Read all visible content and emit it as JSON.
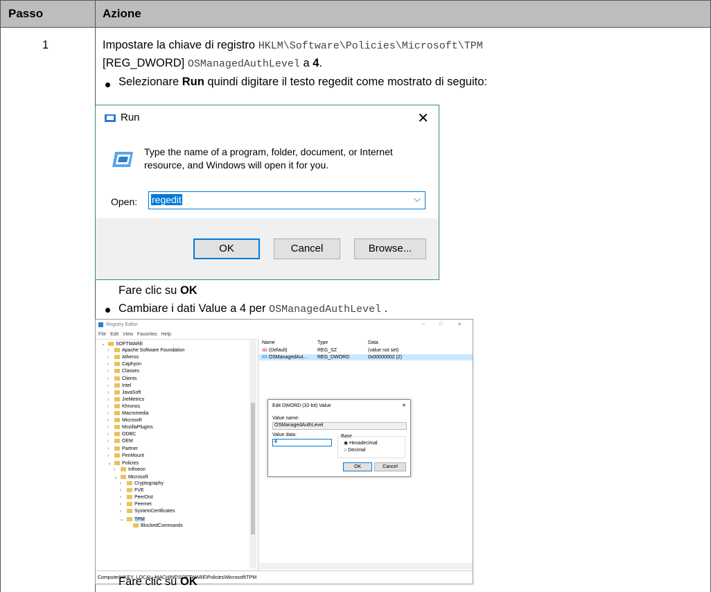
{
  "table": {
    "headers": {
      "step": "Passo",
      "action": "Azione"
    },
    "row_number": "1"
  },
  "content": {
    "line1_prefix": "Impostare la chiave di registro",
    "line1_code": "HKLM\\Software\\Policies\\Microsoft\\TPM",
    "line2_prefix": "[REG_DWORD]",
    "line2_code": "OSManagedAuthLevel",
    "line2_a": "a",
    "line2_value": "4",
    "bullet1_pre": "Selezionare",
    "bullet1_bold": "Run",
    "bullet1_post": "quindi digitare il testo regedit come mostrato di seguito:",
    "click_ok_1_pre": "Fare clic su",
    "click_ok_1_bold": "OK",
    "bullet2_pre": "Cambiare i dati Value a 4 per",
    "bullet2_code": "OSManagedAuthLevel",
    "bullet2_post": ".",
    "click_ok_2_pre": "Fare clic su",
    "click_ok_2_bold": "OK"
  },
  "run_dialog": {
    "title": "Run",
    "description_line1": "Type the name of a program, folder, document, or Internet",
    "description_line2": "resource, and Windows will open it for you.",
    "open_label": "Open:",
    "open_value": "regedit",
    "ok": "OK",
    "cancel": "Cancel",
    "browse": "Browse..."
  },
  "registry_editor": {
    "title": "Registry Editor",
    "menu": [
      "File",
      "Edit",
      "View",
      "Favorites",
      "Help"
    ],
    "tree": [
      "SOFTWARE",
      "Apache Software Foundation",
      "Atheros",
      "Caphyon",
      "Classes",
      "Clients",
      "Intel",
      "JavaSoft",
      "JreMetrics",
      "Khronos",
      "Macromedia",
      "Microsoft",
      "MozillaPlugins",
      "ODBC",
      "OEM",
      "Partner",
      "PenMount",
      "Policies",
      "Infineon",
      "Microsoft",
      "Cryptography",
      "FVE",
      "PeerDist",
      "Peernet",
      "SystemCertificates",
      "TPM",
      "BlockedCommands"
    ],
    "columns": [
      "Name",
      "Type",
      "Data"
    ],
    "values": [
      {
        "name": "(Default)",
        "type": "REG_SZ",
        "data": "(value not set)"
      },
      {
        "name": "OSManagedAut...",
        "type": "REG_DWORD",
        "data": "0x00000002 (2)"
      }
    ],
    "status_path": "Computer\\HKEY_LOCAL_MACHINE\\SOFTWARE\\Policies\\Microsoft\\TPM",
    "edit_dialog": {
      "title": "Edit DWORD (32-bit) Value",
      "value_name_label": "Value name:",
      "value_name": "OSManagedAuthLevel",
      "value_data_label": "Value data:",
      "value_data": "4",
      "base_label": "Base",
      "hex": "Hexadecimal",
      "dec": "Decimal",
      "ok": "OK",
      "cancel": "Cancel"
    }
  }
}
